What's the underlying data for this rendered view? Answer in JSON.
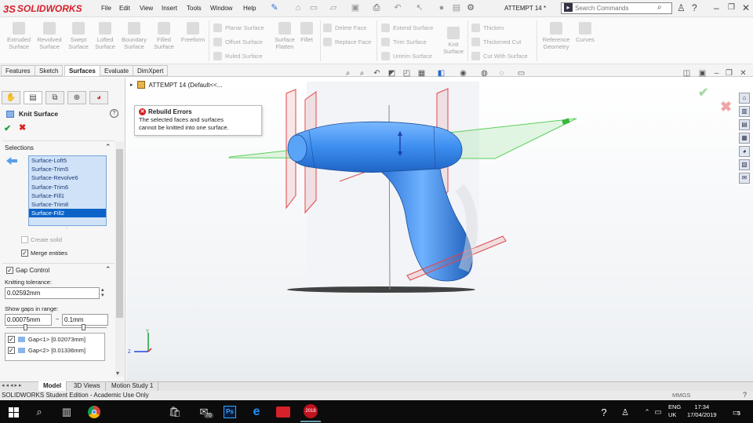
{
  "app": {
    "logo_text": "SOLIDWORKS",
    "doc_title": "ATTEMPT 14 *"
  },
  "menu": [
    "File",
    "Edit",
    "View",
    "Insert",
    "Tools",
    "Window",
    "Help"
  ],
  "search": {
    "placeholder": "Search Commands"
  },
  "ribbon": {
    "big": [
      {
        "label": "Extruded Surface"
      },
      {
        "label": "Revolved Surface"
      },
      {
        "label": "Swept Surface"
      },
      {
        "label": "Lofted Surface"
      },
      {
        "label": "Boundary Surface"
      },
      {
        "label": "Filled Surface"
      },
      {
        "label": "Freeform"
      }
    ],
    "group1": [
      "Planar Surface",
      "Offset Surface",
      "Ruled Surface"
    ],
    "flatten": "Surface Flatten",
    "fillet": "Fillet",
    "group2": [
      "Delete Face",
      "Replace Face"
    ],
    "group3": [
      "Extend Surface",
      "Trim Surface",
      "Untrim Surface"
    ],
    "knit": "Knit Surface",
    "group4": [
      "Thicken",
      "Thickened Cut",
      "Cut With Surface"
    ],
    "refgeo": "Reference Geometry",
    "curves": "Curves"
  },
  "tabs": [
    "Features",
    "Sketch",
    "Surfaces",
    "Evaluate",
    "DimXpert"
  ],
  "active_tab": "Surfaces",
  "panel": {
    "title": "Knit Surface",
    "selections_label": "Selections",
    "selections": [
      "Surface-Loft5",
      "Surface-Trim5",
      "Surface-Revolve6",
      "Surface-Trim6",
      "Surface-Fill1",
      "Surface-Trim8",
      "Surface-Fill2"
    ],
    "create_solid": "Create solid",
    "merge_entities": "Merge entities",
    "gap_control": "Gap Control",
    "tolerance_label": "Knitting tolerance:",
    "tolerance_value": "0.02592mm",
    "range_label": "Show gaps in range:",
    "range_min": "0.00075mm",
    "range_sep": "~",
    "range_max": "0.1mm",
    "gaps": [
      "Gap<1> [0.02073mm]",
      "Gap<2> [0.01336mm]"
    ]
  },
  "tree": {
    "root": "ATTEMPT 14  (Default<<..."
  },
  "rebuild": {
    "title": "Rebuild Errors",
    "message_line1": "The selected faces and surfaces",
    "message_line2": "cannot be knitted into one surface."
  },
  "bottom_tabs": [
    "Model",
    "3D Views",
    "Motion Study 1"
  ],
  "status": {
    "text": "SOLIDWORKS Student Edition - Academic Use Only",
    "units": "MMGS"
  },
  "taskbar": {
    "lang1": "ENG",
    "lang2": "UK",
    "time": "17:34",
    "date": "17/04/2019",
    "mail_badge": "70",
    "notif": "5",
    "sw_label": "2018"
  },
  "triad": {
    "y": "Y",
    "z": "Z"
  },
  "colors": {
    "brand": "#d6202a",
    "model": "#3c8ef0",
    "plane_green": "#67d867",
    "plane_red": "#e0474c",
    "selection": "#0b63c8"
  }
}
